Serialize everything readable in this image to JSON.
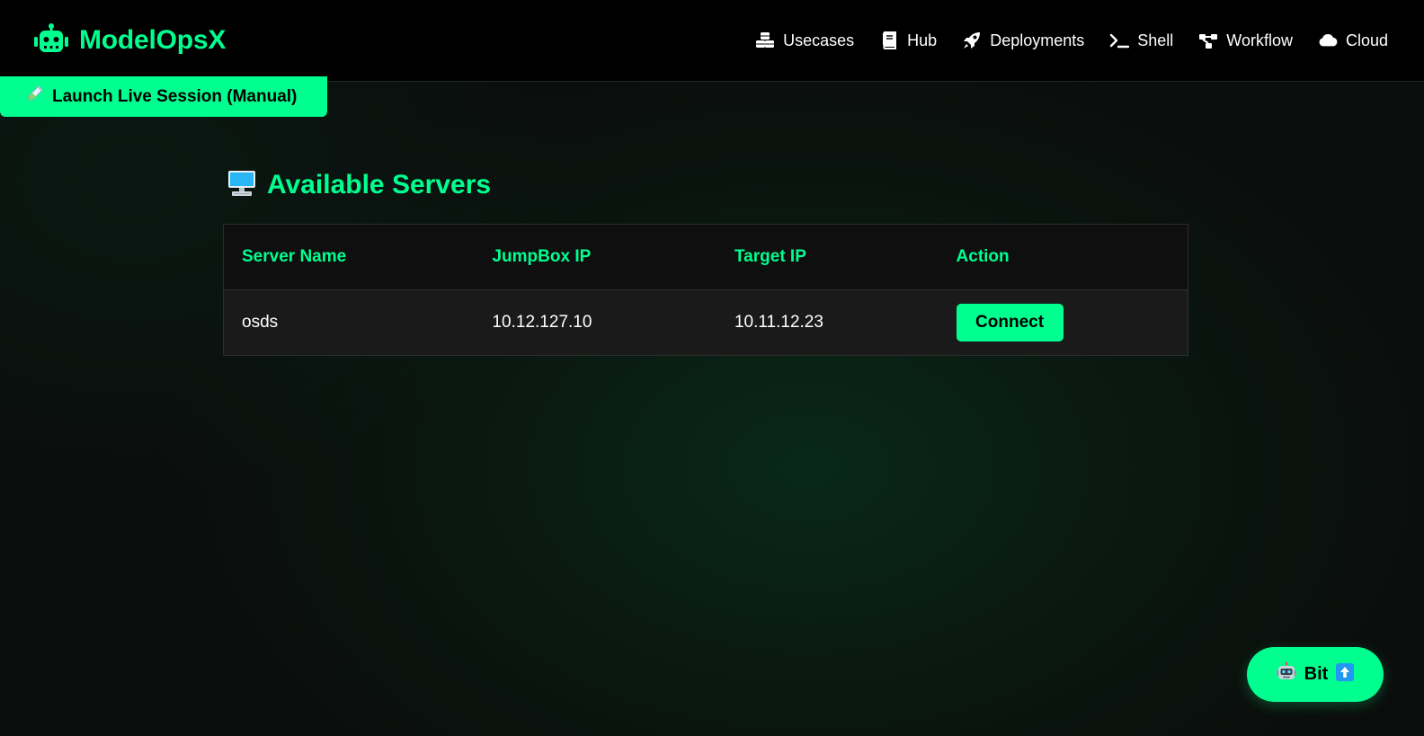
{
  "brand": {
    "name": "ModelOpsX",
    "icon": "robot-icon",
    "color": "#00ff8f"
  },
  "nav": {
    "items": [
      {
        "label": "Usecases",
        "icon": "cubes-icon"
      },
      {
        "label": "Hub",
        "icon": "book-icon"
      },
      {
        "label": "Deployments",
        "icon": "rocket-icon"
      },
      {
        "label": "Shell",
        "icon": "terminal-icon"
      },
      {
        "label": "Workflow",
        "icon": "sitemap-icon"
      },
      {
        "label": "Cloud",
        "icon": "cloud-icon"
      }
    ]
  },
  "launch": {
    "label": "Launch Live Session (Manual)",
    "icon": "test-tube-icon"
  },
  "servers": {
    "title": "Available Servers",
    "icon": "desktop-computer-icon",
    "columns": [
      "Server Name",
      "JumpBox IP",
      "Target IP",
      "Action"
    ],
    "rows": [
      {
        "name": "osds",
        "jumpbox_ip": "10.12.127.10",
        "target_ip": "10.11.12.23",
        "action_label": "Connect"
      }
    ]
  },
  "assistant": {
    "label": "Bit",
    "icon": "robot-face-icon",
    "toggle_icon": "arrow-up-icon"
  },
  "colors": {
    "accent": "#00ff8f",
    "navbar_bg": "#000000",
    "header_row_bg": "#0f0f0f",
    "data_row_bg": "#1a1a1a"
  }
}
